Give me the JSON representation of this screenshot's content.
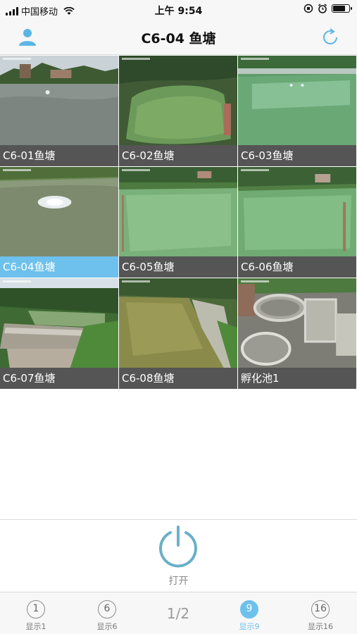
{
  "status_bar": {
    "carrier": "中国移动",
    "time": "上午 9:54"
  },
  "nav": {
    "title": "C6-04 鱼塘",
    "left_icon": "user-icon",
    "right_icon": "refresh-icon",
    "accent": "#6ec1ec"
  },
  "cameras": [
    {
      "label": "C6-01鱼塘"
    },
    {
      "label": "C6-02鱼塘"
    },
    {
      "label": "C6-03鱼塘"
    },
    {
      "label": "C6-04鱼塘",
      "selected": true
    },
    {
      "label": "C6-05鱼塘"
    },
    {
      "label": "C6-06鱼塘"
    },
    {
      "label": "C6-07鱼塘"
    },
    {
      "label": "C6-08鱼塘"
    },
    {
      "label": "孵化池1"
    }
  ],
  "power": {
    "label": "打开",
    "icon": "power-icon"
  },
  "tabs": [
    {
      "number": "1",
      "label": "显示1"
    },
    {
      "number": "6",
      "label": "显示6"
    },
    {
      "number": "9",
      "label": "显示9",
      "active": true
    },
    {
      "number": "16",
      "label": "显示16"
    }
  ],
  "page_indicator": "1/2"
}
